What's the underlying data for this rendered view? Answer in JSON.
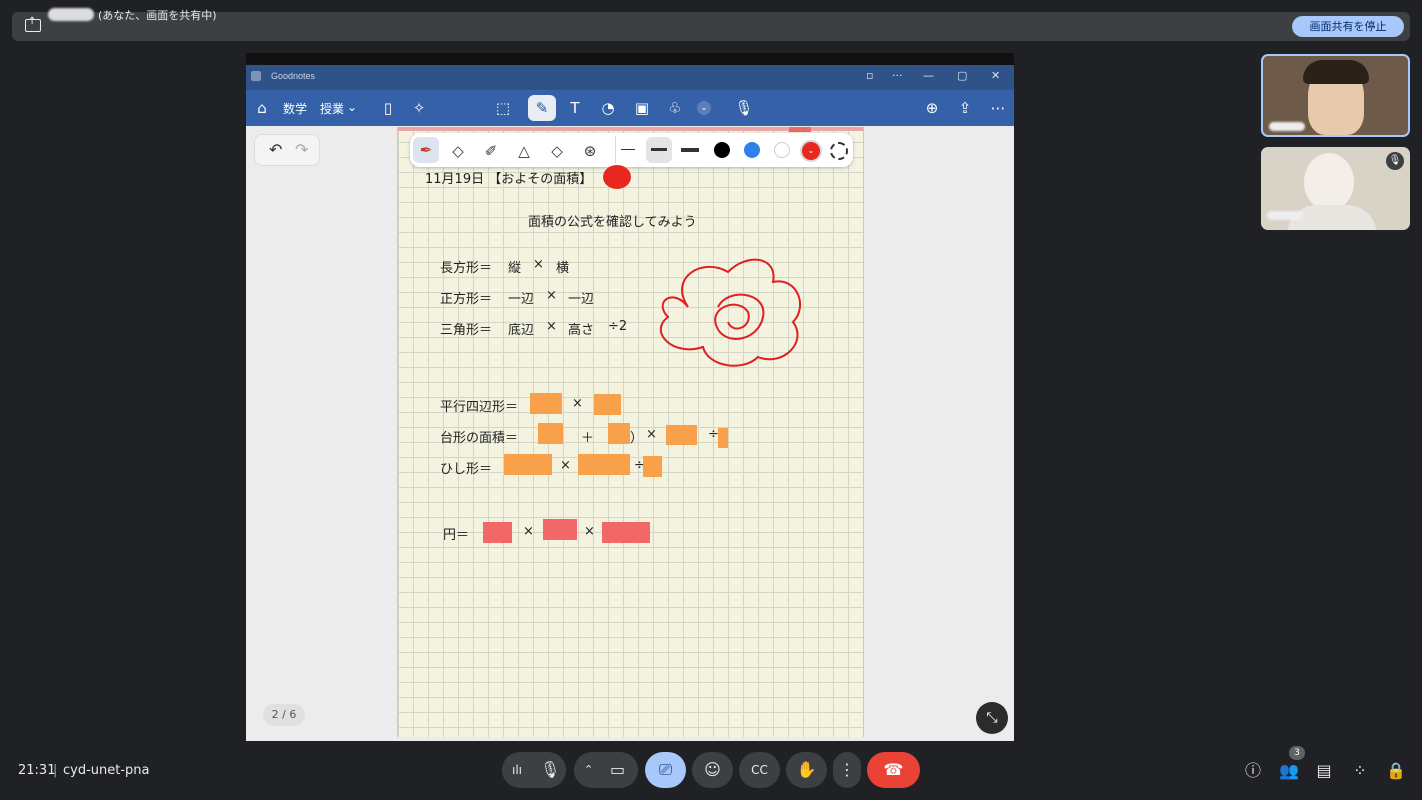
{
  "share_bar": {
    "text": "(あなた、画面を共有中)",
    "stop_button": "画面共有を停止"
  },
  "goodnotes": {
    "app_title": "Goodnotes",
    "toolbar": {
      "subject": "数学",
      "section": "授業"
    },
    "page_counter": "2 / 6"
  },
  "notebook": {
    "date_title": "11月19日 【およその面積】",
    "heading": "面積の公式を確認してみよう",
    "formulas": {
      "rectangle": [
        "長方形＝",
        "縦",
        "×",
        "横"
      ],
      "square": [
        "正方形＝",
        "一辺",
        "×",
        "一辺"
      ],
      "triangle": [
        "三角形＝",
        "底辺",
        "×",
        "高さ",
        "÷2"
      ],
      "parallelogram": [
        "平行四辺形＝",
        "×"
      ],
      "trapezoid": [
        "台形の面積＝",
        "（",
        "＋",
        "）",
        "×",
        "÷"
      ],
      "rhombus": [
        "ひし形＝",
        "×",
        "÷"
      ],
      "circle": [
        "円＝",
        "×",
        "×"
      ]
    }
  },
  "meeting": {
    "time": "21:31",
    "code": "cyd-unet-pna",
    "participant_count": "3"
  },
  "colors": {
    "accent": "#3461a8",
    "end_call": "#ea4335",
    "sticky_orange": "#f9a04b",
    "sticky_red": "#f26868"
  }
}
